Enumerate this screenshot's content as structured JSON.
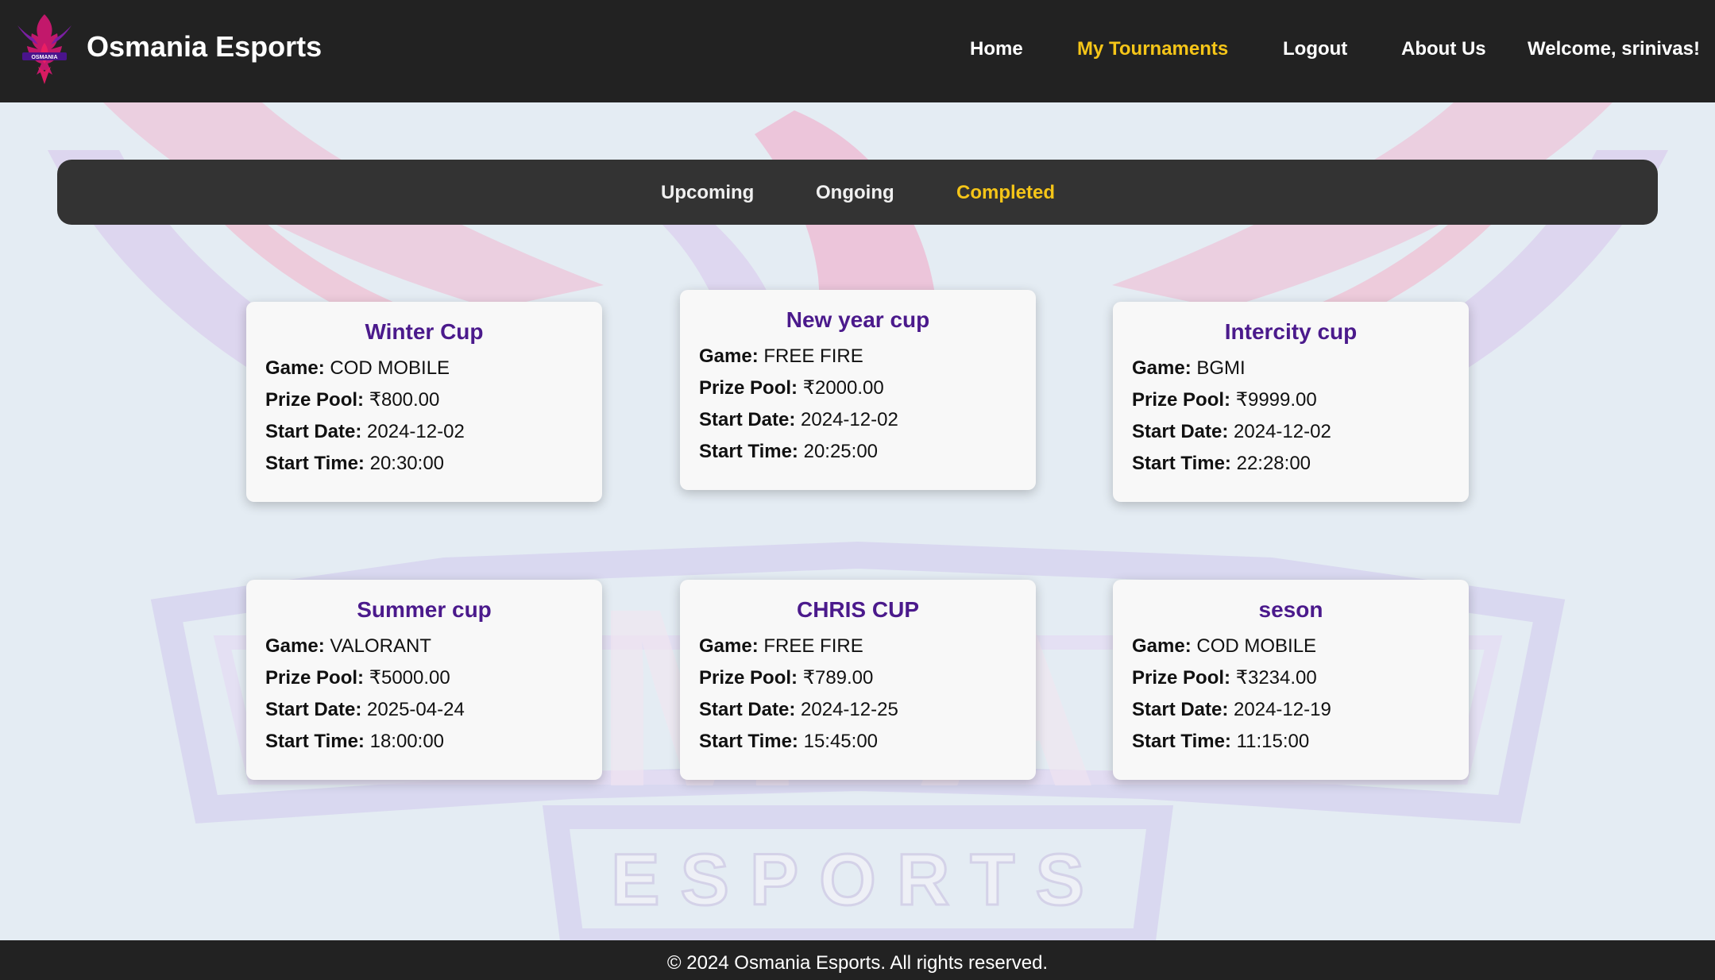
{
  "brand": {
    "name": "Osmania Esports",
    "logo_icon": "phoenix-logo-icon",
    "logo_text": "OSMANIA"
  },
  "nav": {
    "home": "Home",
    "my_tournaments": "My Tournaments",
    "logout": "Logout",
    "about": "About Us",
    "welcome": "Welcome, srinivas!"
  },
  "tabs": {
    "upcoming": "Upcoming",
    "ongoing": "Ongoing",
    "completed": "Completed",
    "active": "Completed"
  },
  "labels": {
    "game": "Game:",
    "prize_pool": "Prize Pool:",
    "start_date": "Start Date:",
    "start_time": "Start Time:"
  },
  "tournaments": [
    {
      "name": "Winter Cup",
      "game": "COD MOBILE",
      "prize": "₹800.00",
      "date": "2024-12-02",
      "time": "20:30:00"
    },
    {
      "name": "New year cup",
      "game": "FREE FIRE",
      "prize": "₹2000.00",
      "date": "2024-12-02",
      "time": "20:25:00"
    },
    {
      "name": "Intercity cup",
      "game": "BGMI",
      "prize": "₹9999.00",
      "date": "2024-12-02",
      "time": "22:28:00"
    },
    {
      "name": "Summer cup",
      "game": "VALORANT",
      "prize": "₹5000.00",
      "date": "2025-04-24",
      "time": "18:00:00"
    },
    {
      "name": "CHRIS CUP",
      "game": "FREE FIRE",
      "prize": "₹789.00",
      "date": "2024-12-25",
      "time": "15:45:00"
    },
    {
      "name": "seson",
      "game": "COD MOBILE",
      "prize": "₹3234.00",
      "date": "2024-12-19",
      "time": "11:15:00"
    }
  ],
  "footer": {
    "text": "© 2024 Osmania Esports. All rights reserved."
  },
  "background": {
    "watermark_text": "ESPORTS",
    "watermark_icon": "phoenix-watermark-icon"
  },
  "colors": {
    "header_bg": "#222222",
    "accent": "#f5c518",
    "card_title": "#4b1a8c",
    "page_bg": "#e4ecf3"
  }
}
